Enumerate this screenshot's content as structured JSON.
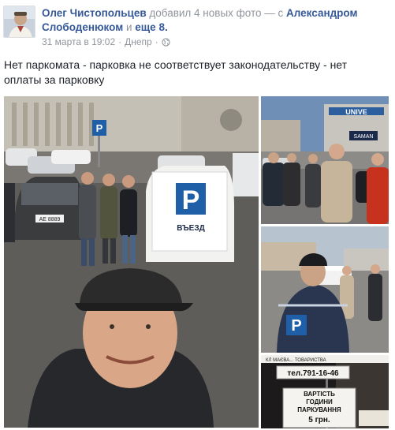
{
  "post": {
    "author": "Олег Чистопольцев",
    "action_text": "добавил 4 новых фото — с",
    "tagged_person": "Александром Слободенюком",
    "and_text": "и",
    "others_link": "еще 8.",
    "date": "31 марта в 19:02",
    "location_sep": "·",
    "location": "Днепр",
    "privacy_sep": "·",
    "text": "Нет паркомата - парковка не соответствует законодательству - нет оплаты за парковку"
  },
  "photos": {
    "main": {
      "sign_letter": "P",
      "sign_text": "ВЪЕЗД",
      "plate_text": "АЕ 8889"
    },
    "photo2": {
      "building_text": "UNIVE",
      "sign_text": "SAMAN"
    },
    "photo3": {
      "vest_letter": "P"
    },
    "photo4": {
      "sign_top": "тел.791-16-46",
      "sign_line1": "ВАРТІСТЬ",
      "sign_line2": "ГОДИНИ",
      "sign_line3": "ПАРКУВАННЯ",
      "sign_line4": "5 грн.",
      "street_text": "КЛ МАЄВА... ТОВАРИСТВА"
    }
  },
  "icons": {
    "privacy": "globe-icon"
  },
  "colors": {
    "link": "#365899",
    "meta": "#90949c",
    "text": "#1d2129"
  }
}
